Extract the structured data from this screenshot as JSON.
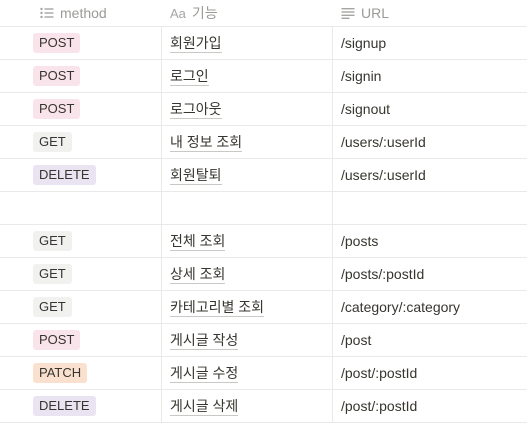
{
  "header": {
    "method_label": "method",
    "feature_label": "기능",
    "feature_icon_text": "Aa",
    "url_label": "URL"
  },
  "tag_colors": {
    "POST": "#f9e4ec",
    "GET": "#f1f1ef",
    "DELETE": "#eae4f2",
    "PATCH": "#fae1cf"
  },
  "rows": [
    {
      "method": "POST",
      "feature": "회원가입",
      "url": "/signup"
    },
    {
      "method": "POST",
      "feature": "로그인",
      "url": "/signin"
    },
    {
      "method": "POST",
      "feature": "로그아웃",
      "url": "/signout"
    },
    {
      "method": "GET",
      "feature": "내 정보 조회",
      "url": "/users/:userId"
    },
    {
      "method": "DELETE",
      "feature": "회원탈퇴",
      "url": "/users/:userId"
    },
    {
      "method": "",
      "feature": "",
      "url": ""
    },
    {
      "method": "GET",
      "feature": "전체 조회",
      "url": "/posts"
    },
    {
      "method": "GET",
      "feature": "상세 조회",
      "url": "/posts/:postId"
    },
    {
      "method": "GET",
      "feature": "카테고리별 조회",
      "url": "/category/:category"
    },
    {
      "method": "POST",
      "feature": "게시글 작성",
      "url": "/post"
    },
    {
      "method": "PATCH",
      "feature": "게시글 수정",
      "url": "/post/:postId"
    },
    {
      "method": "DELETE",
      "feature": "게시글 삭제",
      "url": "/post/:postId"
    }
  ]
}
